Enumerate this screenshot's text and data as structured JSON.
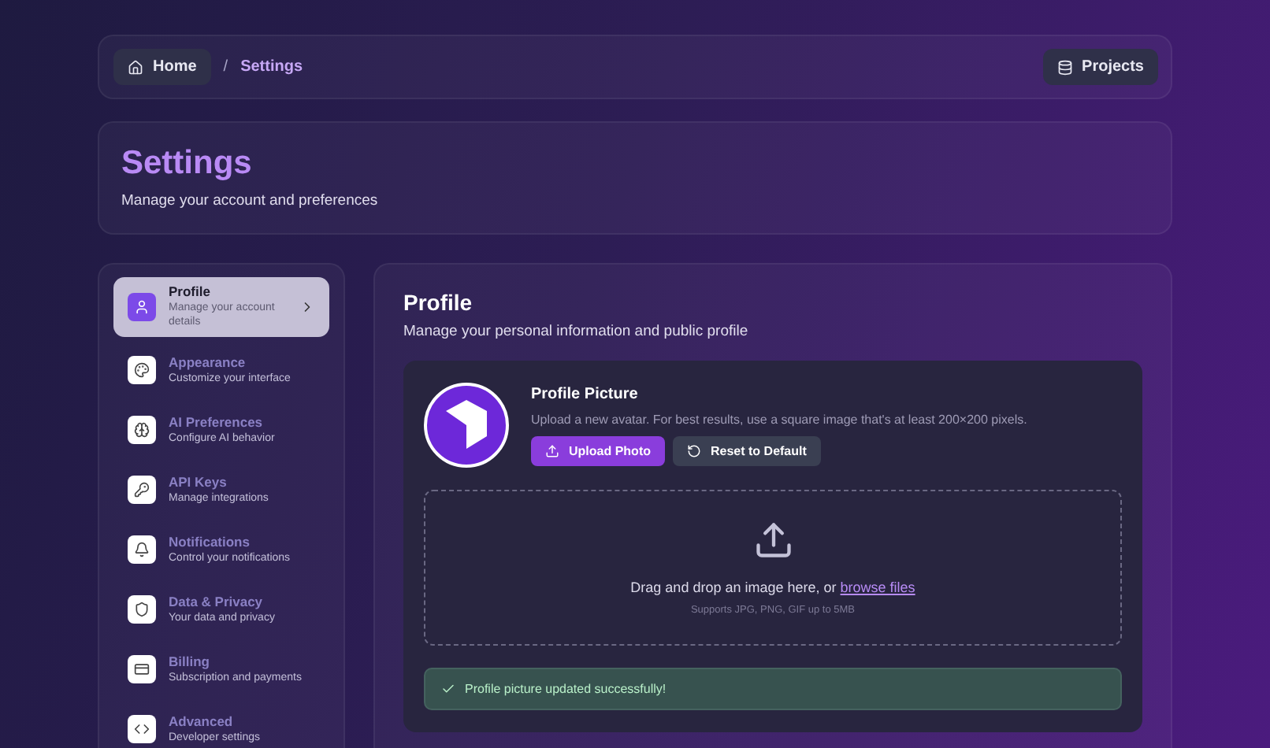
{
  "breadcrumb": {
    "home": "Home",
    "separator": "/",
    "current": "Settings",
    "projects": "Projects"
  },
  "header": {
    "title": "Settings",
    "subtitle": "Manage your account and preferences"
  },
  "nav": [
    {
      "kind": "user",
      "title": "Profile",
      "description": "Manage your account details",
      "selected": true
    },
    {
      "kind": "palette",
      "title": "Appearance",
      "description": "Customize your interface",
      "selected": false
    },
    {
      "kind": "ai",
      "title": "AI Preferences",
      "description": "Configure AI behavior",
      "selected": false
    },
    {
      "kind": "key",
      "title": "API Keys",
      "description": "Manage integrations",
      "selected": false
    },
    {
      "kind": "bell",
      "title": "Notifications",
      "description": "Control your notifications",
      "selected": false
    },
    {
      "kind": "shield",
      "title": "Data & Privacy",
      "description": "Your data and privacy",
      "selected": false
    },
    {
      "kind": "card",
      "title": "Billing",
      "description": "Subscription and payments",
      "selected": false
    },
    {
      "kind": "code",
      "title": "Advanced",
      "description": "Developer settings",
      "selected": false
    }
  ],
  "profile": {
    "title": "Profile",
    "subtitle": "Manage your personal information and public profile",
    "picture": {
      "title": "Profile Picture",
      "description": "Upload a new avatar. For best results, use a square image that's at least 200×200 pixels.",
      "upload_button": "Upload Photo",
      "reset_button": "Reset to Default"
    },
    "dropzone": {
      "text": "Drag and drop an image here, or",
      "link": "browse files",
      "hint": "Supports JPG, PNG, GIF up to 5MB"
    },
    "success": "Profile picture updated successfully!"
  }
}
